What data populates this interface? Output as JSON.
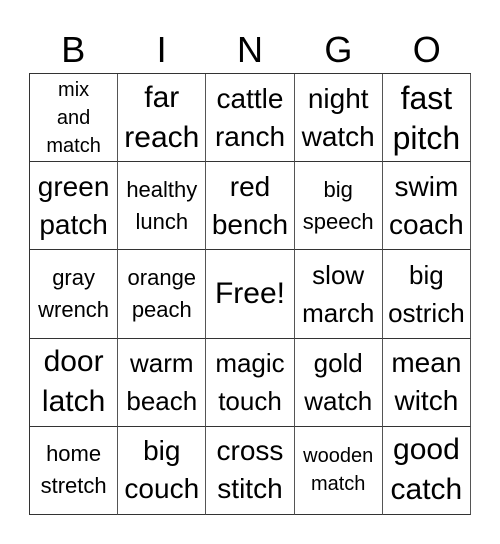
{
  "header": {
    "letters": [
      "B",
      "I",
      "N",
      "G",
      "O"
    ]
  },
  "grid": {
    "rows": [
      [
        "mix\nand\nmatch",
        "far\nreach",
        "cattle\nranch",
        "night\nwatch",
        "fast\npitch"
      ],
      [
        "green\npatch",
        "healthy\nlunch",
        "red\nbench",
        "big\nspeech",
        "swim\ncoach"
      ],
      [
        "gray\nwrench",
        "orange\npeach",
        "Free!",
        "slow\nmarch",
        "big\nostrich"
      ],
      [
        "door\nlatch",
        "warm\nbeach",
        "magic\ntouch",
        "gold\nwatch",
        "mean\nwitch"
      ],
      [
        "home\nstretch",
        "big\ncouch",
        "cross\nstitch",
        "wooden\nmatch",
        "good\ncatch"
      ]
    ]
  }
}
